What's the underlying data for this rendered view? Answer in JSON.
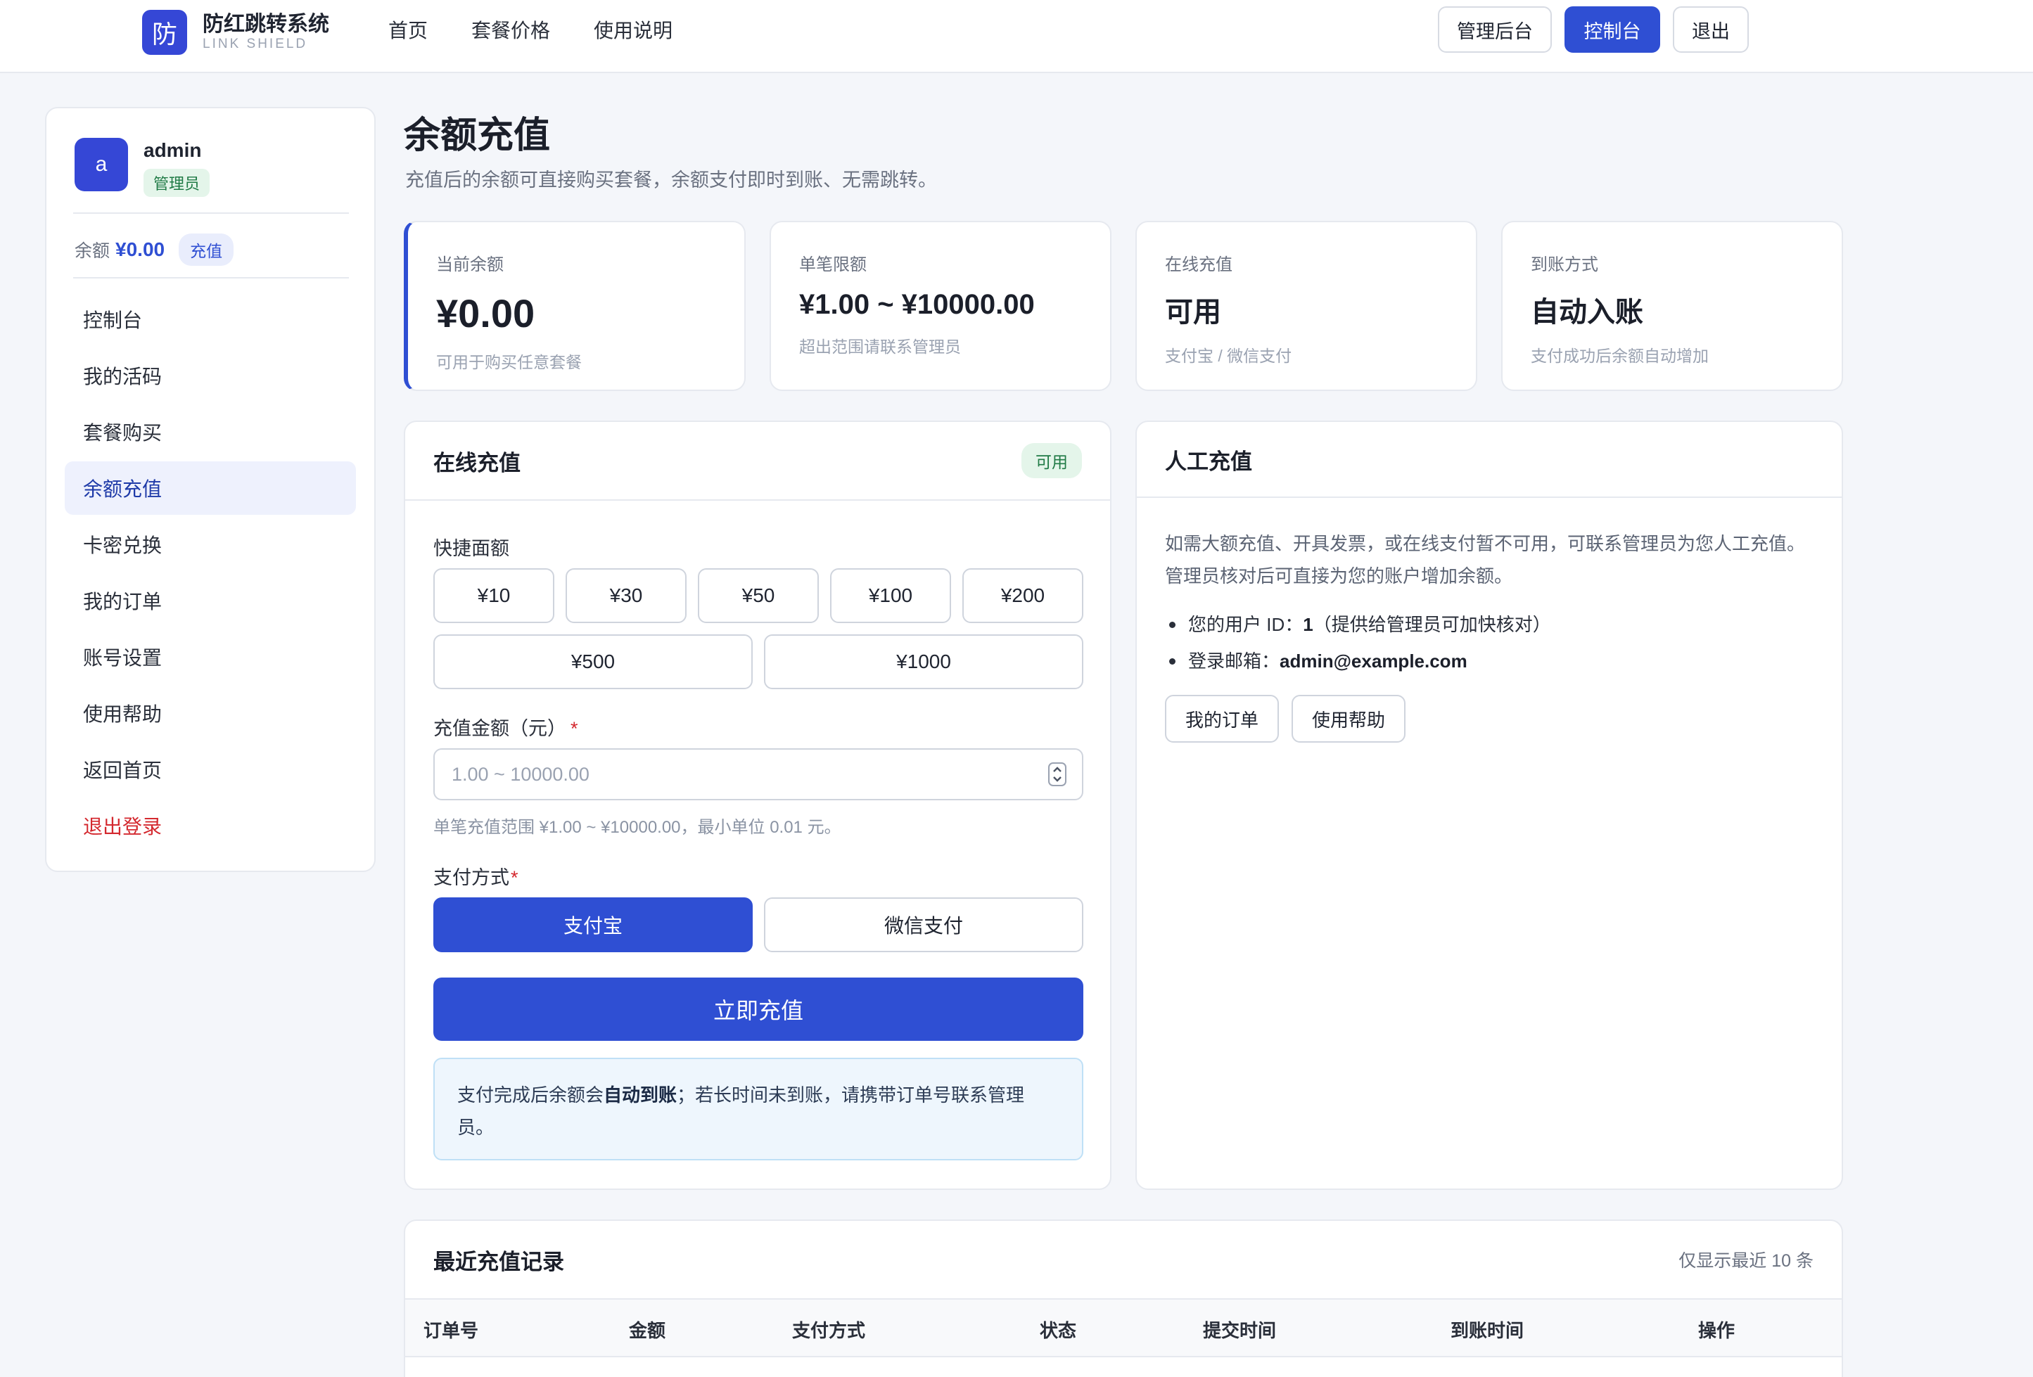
{
  "header": {
    "brand_logo": "防",
    "brand_name": "防红跳转系统",
    "brand_sub": "LINK SHIELD",
    "nav": [
      "首页",
      "套餐价格",
      "使用说明"
    ],
    "actions": {
      "admin": "管理后台",
      "console": "控制台",
      "logout": "退出"
    }
  },
  "sidebar": {
    "avatar_letter": "a",
    "username": "admin",
    "role": "管理员",
    "balance_label": "余额",
    "balance_value": "¥0.00",
    "recharge_link": "充值",
    "items": [
      "控制台",
      "我的活码",
      "套餐购买",
      "余额充值",
      "卡密兑换",
      "我的订单",
      "账号设置",
      "使用帮助",
      "返回首页",
      "退出登录"
    ],
    "active_index": 3
  },
  "page": {
    "title": "余额充值",
    "subtitle": "充值后的余额可直接购买套餐，余额支付即时到账、无需跳转。"
  },
  "stats": [
    {
      "label": "当前余额",
      "value": "¥0.00",
      "note": "可用于购买任意套餐"
    },
    {
      "label": "单笔限额",
      "value": "¥1.00 ~ ¥10000.00",
      "note": "超出范围请联系管理员"
    },
    {
      "label": "在线充值",
      "value": "可用",
      "note": "支付宝 / 微信支付"
    },
    {
      "label": "到账方式",
      "value": "自动入账",
      "note": "支付成功后余额自动增加"
    }
  ],
  "online": {
    "title": "在线充值",
    "badge": "可用",
    "quick_label": "快捷面额",
    "amounts": [
      "¥10",
      "¥30",
      "¥50",
      "¥100",
      "¥200",
      "¥500",
      "¥1000"
    ],
    "amount_label": "充值金额（元）",
    "required_mark": "*",
    "amount_placeholder": "1.00 ~ 10000.00",
    "amount_hint": "单笔充值范围 ¥1.00 ~ ¥10000.00，最小单位 0.01 元。",
    "pay_label": "支付方式",
    "pay_methods": [
      "支付宝",
      "微信支付"
    ],
    "selected_pay": 0,
    "submit": "立即充值",
    "notice_pre": "支付完成后余额会",
    "notice_bold": "自动到账",
    "notice_post": "；若长时间未到账，请携带订单号联系管理员。"
  },
  "manual": {
    "title": "人工充值",
    "desc": "如需大额充值、开具发票，或在线支付暂不可用，可联系管理员为您人工充值。管理员核对后可直接为您的账户增加余额。",
    "uid_label": "您的用户 ID：",
    "uid_value": "1",
    "uid_note": "（提供给管理员可加快核对）",
    "email_label": "登录邮箱：",
    "email_value": "admin@example.com",
    "btn_orders": "我的订单",
    "btn_help": "使用帮助"
  },
  "records": {
    "title": "最近充值记录",
    "note": "仅显示最近 10 条",
    "columns": [
      "订单号",
      "金额",
      "支付方式",
      "状态",
      "提交时间",
      "到账时间",
      "操作"
    ]
  }
}
